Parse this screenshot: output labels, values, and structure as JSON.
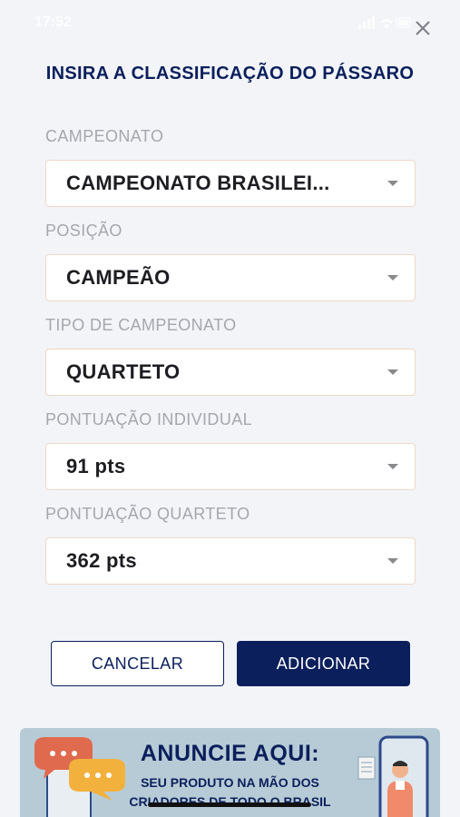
{
  "status_bar": {
    "time": "17:52"
  },
  "title": "INSIRA A CLASSIFICAÇÃO DO PÁSSARO",
  "fields": [
    {
      "label": "CAMPEONATO",
      "value": "CAMPEONATO BRASILEI..."
    },
    {
      "label": "POSIÇÃO",
      "value": "CAMPEÃO"
    },
    {
      "label": "TIPO DE CAMPEONATO",
      "value": "QUARTETO"
    },
    {
      "label": "PONTUAÇÃO INDIVIDUAL",
      "value": "91 pts"
    },
    {
      "label": "PONTUAÇÃO QUARTETO",
      "value": "362 pts"
    }
  ],
  "buttons": {
    "cancel": "CANCELAR",
    "add": "ADICIONAR"
  },
  "ad": {
    "headline": "ANUNCIE AQUI:",
    "line1": "SEU PRODUTO NA MÃO DOS",
    "line2": "CRIADORES DE TODO O BRASIL"
  },
  "colors": {
    "primary": "#0b1f5c",
    "field_border": "#f0d7c6",
    "ad_background": "#b7cbd6"
  }
}
